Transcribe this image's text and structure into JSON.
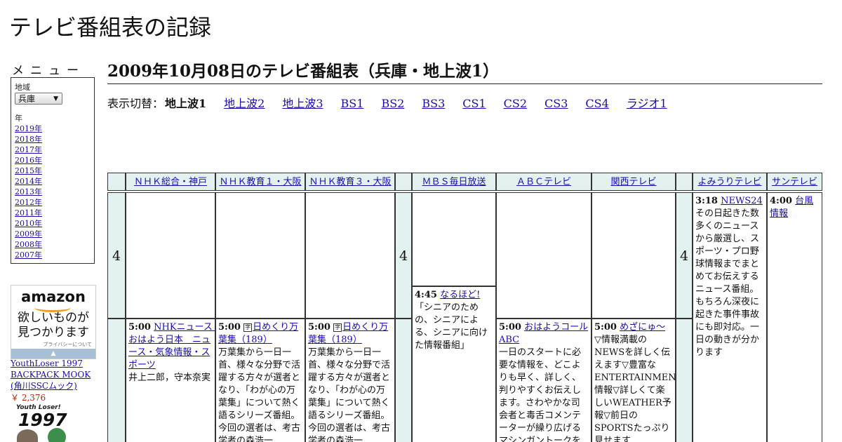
{
  "site": {
    "title": "テレビ番組表の記録"
  },
  "menu": {
    "heading": "メニュー",
    "region_label": "地域",
    "region_value": "兵庫",
    "year_label": "年",
    "years": [
      "2019年",
      "2018年",
      "2017年",
      "2016年",
      "2015年",
      "2014年",
      "2013年",
      "2012年",
      "2011年",
      "2010年",
      "2009年",
      "2008年",
      "2007年"
    ]
  },
  "ad": {
    "logo": "amazon",
    "tagline_1": "欲しいものが",
    "tagline_2": "見つかります",
    "privacy": "プライバシーについて",
    "product_title": "YouthLoser 1997 BACKPACK MOOK (角川SSCムック)",
    "product_price": "￥ 2,376",
    "thumb_line1": "Youth Loser!",
    "thumb_line2": "1997"
  },
  "main": {
    "title": "2009年10月08日のテレビ番組表（兵庫・地上波1）",
    "switch_label": "表示切替：",
    "current": "地上波1",
    "links": [
      "地上波2",
      "地上波3",
      "BS1",
      "BS2",
      "BS3",
      "CS1",
      "CS2",
      "CS3",
      "CS4",
      "ラジオ1"
    ]
  },
  "guide": {
    "hour": "4",
    "channels": [
      "ＮＨＫ総合・神戸",
      "ＮＨＫ教育１・大阪",
      "ＮＨＫ教育３・大阪",
      "ＭＢＳ毎日放送",
      "ＡＢＣテレビ",
      "関西テレビ",
      "よみうりテレビ",
      "サンテレビ"
    ],
    "programs": {
      "nhk_sogo": {
        "time": "5:00",
        "title": "NHKニュース　おはよう日本　ニュース・気象情報・スポーツ",
        "desc": "井上二郎，守本奈実"
      },
      "nhk_edu1": {
        "time": "5:00",
        "icon": "字",
        "title": "日めくり万葉集（189）",
        "desc": "万葉集から一日一首、様々な分野で活躍する方々が選者となり、「わが心の万葉集」について熱く語るシリーズ番組。今回の選者は、考古学者の森浩一"
      },
      "nhk_edu3": {
        "time": "5:00",
        "icon": "字",
        "title": "日めくり万葉集（189）",
        "desc": "万葉集から一日一首、様々な分野で活躍する方々が選者となり、「わが心の万葉集」について熱く語るシリーズ番組。今回の選者は、考古学者の森浩一"
      },
      "mbs": {
        "time": "4:45",
        "title": "なるほど!",
        "desc": "「シニアのための、シニアによる、シニアに向けた情報番組」"
      },
      "abc": {
        "time": "5:00",
        "title": "おはようコールABC",
        "desc": "一日のスタートに必要な情報を、どこよりも早く、詳しく、判りやすくお伝えします。さわやかな司会者と毒舌コメンテーターが繰り広げるマシンガントークを"
      },
      "ktv": {
        "time": "5:00",
        "title": "めざにゅ～",
        "desc": "▽情報満載のNEWSを詳しく伝えます▽豊富なENTERTAINMENT情報▽詳しくて楽しいWEATHER予報▽前日のSPORTSたっぷり見せます"
      },
      "ytv": {
        "time": "3:18",
        "title": "NEWS24",
        "desc": "その日起きた数多くのニュースから厳選し、スポーツ・プロ野球情報までまとめてお伝えするニュース番組。もちろん深夜に起きた事件事故にも即対応。一日の動きが分かります"
      },
      "suntv": {
        "time": "4:00",
        "title": "台風情報",
        "desc": ""
      }
    }
  },
  "colors": {
    "header_bg": "#e3f1f1",
    "link": "#1a0dab"
  }
}
